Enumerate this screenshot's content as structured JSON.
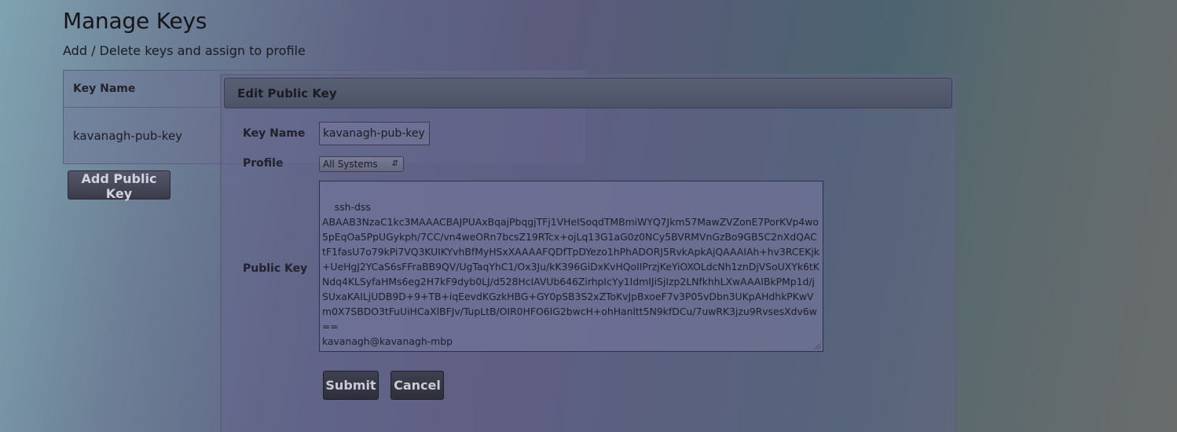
{
  "page": {
    "title": "Manage Keys",
    "subtitle": "Add / Delete keys and assign to profile"
  },
  "keys_table": {
    "column_header": "Key Name",
    "rows": [
      {
        "key_name": "kavanagh-pub-key"
      }
    ]
  },
  "add_button_label": "Add Public Key",
  "modal": {
    "title": "Edit Public Key",
    "key_name_label": "Key Name",
    "key_name_value": "kavanagh-pub-key",
    "profile_label": "Profile",
    "profile_value": "All Systems",
    "public_key_label": "Public Key",
    "public_key_value": "ssh-dss\nABAAB3NzaC1kc3MAAACBAJPUAxBqajPbqgjTFj1VHeISoqdTMBmiWYQ7Jkm57MawZVZonE7PorKVp4wo5pEqOa5PpUGykph/7CC/vn4weORn7bcsZ19RTcx+ojLq13G1aG0z0NCy5BVRMVnGzBo9GB5C2nXdQACtF1fasU7o79kPi7VQ3KUIKYvhBfMyHSxXAAAAFQDfTpDYezo1hPhADORJ5RvkApkAjQAAAIAh+hv3RCEKjk+UeHgJ2YCaS6sFFraBB9QV/UgTaqYhC1/Ox3Ju/kK396GiDxKvHQoIIPrzjKeYiOXOLdcNh1znDjVSoUXYk6tKNdq4KLSyfaHMs6eg2H7kF9dyb0LJ/d528HcIAVUb646ZirhpIcYy1IdmIJiSjIzp2LNfkhhLXwAAAIBkPMp1d/jSUxaKAILjUDB9D+9+TB+iqEevdKGzkHBG+GY0pSB3S2xZToKvJpBxoeF7v3P05vDbn3UKpAHdhkPKwVm0X7SBDO3tFuUiHCaXlBFJv/TupLtB/OIR0HFO6IG2bwcH+ohHanltt5N9kfDCu/7uwRK3jzu9RvsesXdv6w==\nkavanagh@kavanagh-mbp",
    "submit_label": "Submit",
    "cancel_label": "Cancel"
  }
}
